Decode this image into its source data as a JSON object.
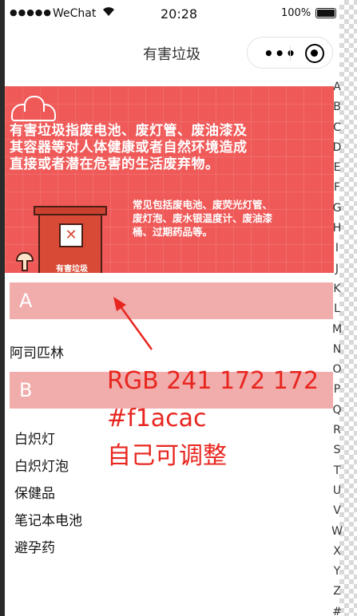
{
  "status_bar": {
    "signal": "●●●●●",
    "carrier": "WeChat",
    "time": "20:28",
    "battery_text": "100%"
  },
  "nav": {
    "title": "有害垃圾",
    "more_glyph": "•••"
  },
  "banner": {
    "main_text_lines": [
      "有害垃圾指废电池、废灯管、废油漆及",
      "其容器等对人体健康或者自然环境造成",
      "直接或者潜在危害的生活废弃物。"
    ],
    "sub_text_lines": [
      "常见包括废电池、废荧光灯管、",
      "废灯泡、废水银温度计、废油漆",
      "桶、过期药品等。"
    ],
    "bin_label": "有害垃圾"
  },
  "sections": [
    {
      "letter": "A",
      "items": [
        "阿司匹林"
      ]
    },
    {
      "letter": "B",
      "items": [
        "白炽灯",
        "白炽灯泡",
        "保健品",
        "笔记本电池",
        "避孕药"
      ]
    }
  ],
  "index_letters": [
    "A",
    "B",
    "C",
    "D",
    "E",
    "F",
    "G",
    "H",
    "I",
    "J",
    "K",
    "L",
    "M",
    "N",
    "O",
    "P",
    "Q",
    "R",
    "S",
    "T",
    "U",
    "V",
    "W",
    "X",
    "Y",
    "Z",
    "#"
  ],
  "annotation": {
    "line1": "RGB 241 172 172",
    "line2": "#f1acac",
    "line3": "自己可调整"
  },
  "colors": {
    "section_header_bg": "#f1acac",
    "banner_bg": "#ef5a59",
    "annotation": "#e8261f"
  }
}
